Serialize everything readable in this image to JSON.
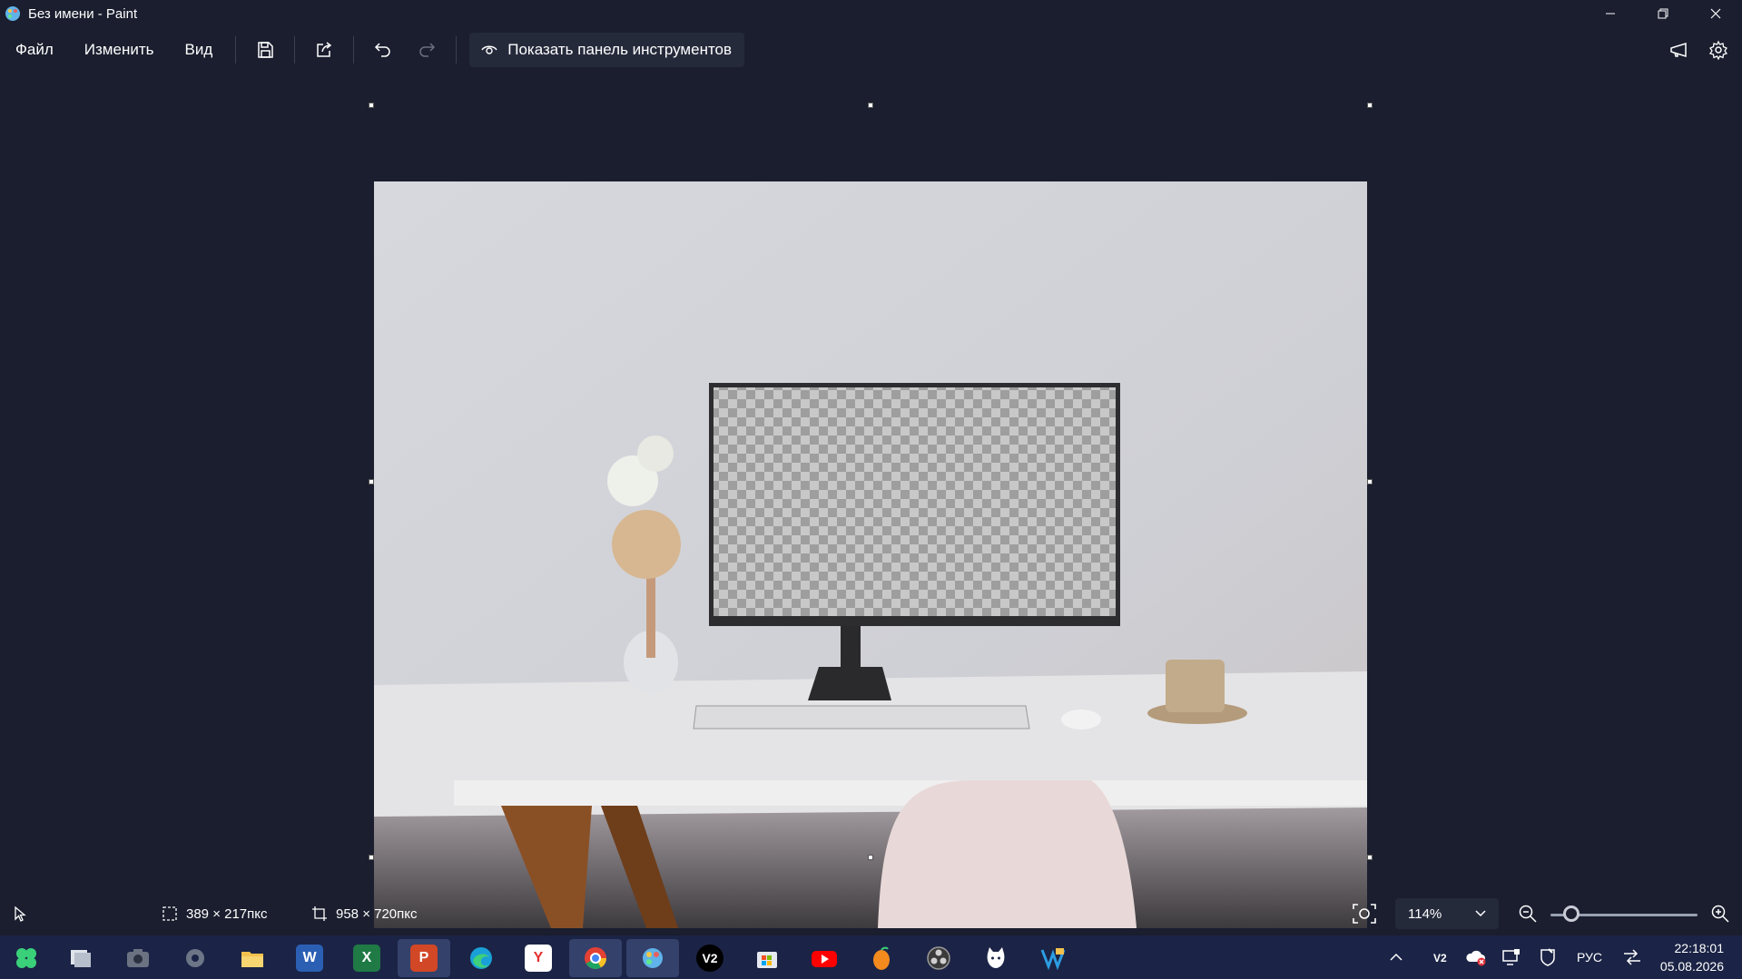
{
  "window": {
    "title": "Без имени - Paint"
  },
  "menu": {
    "file": "Файл",
    "edit": "Изменить",
    "view": "Вид",
    "show_toolbar_label": "Показать панель инструментов"
  },
  "status": {
    "selection_size": "389 × 217пкс",
    "canvas_size": "958 × 720пкс",
    "zoom": "114%",
    "zoom_percent": 114
  },
  "taskbar": {
    "apps": [
      {
        "name": "start",
        "icon": "clover-icon"
      },
      {
        "name": "task-view",
        "icon": "task-view-icon"
      },
      {
        "name": "camera",
        "icon": "camera-icon"
      },
      {
        "name": "settings",
        "icon": "gear-icon"
      },
      {
        "name": "explorer",
        "icon": "folder-icon"
      },
      {
        "name": "word",
        "icon": "word-icon",
        "label": "W"
      },
      {
        "name": "excel",
        "icon": "excel-icon",
        "label": "X"
      },
      {
        "name": "powerpoint",
        "icon": "powerpoint-icon",
        "label": "P"
      },
      {
        "name": "edge",
        "icon": "edge-icon"
      },
      {
        "name": "yandex",
        "icon": "yandex-icon",
        "label": "Y"
      },
      {
        "name": "chrome",
        "icon": "chrome-icon"
      },
      {
        "name": "paint",
        "icon": "paint-icon"
      },
      {
        "name": "v2",
        "icon": "v2-icon",
        "label": "V2"
      },
      {
        "name": "store",
        "icon": "store-icon"
      },
      {
        "name": "youtube",
        "icon": "youtube-icon"
      },
      {
        "name": "fl-studio",
        "icon": "fruit-icon"
      },
      {
        "name": "obs",
        "icon": "obs-icon"
      },
      {
        "name": "cat-app",
        "icon": "cat-icon"
      },
      {
        "name": "vs",
        "icon": "vs-icon"
      }
    ],
    "tray": {
      "language": "РУС",
      "time": "22:18:01",
      "date": "05.08.2026"
    }
  },
  "colors": {
    "background": "#1a1e2e",
    "taskbar": "#1b2446",
    "accent": "#34416b"
  }
}
